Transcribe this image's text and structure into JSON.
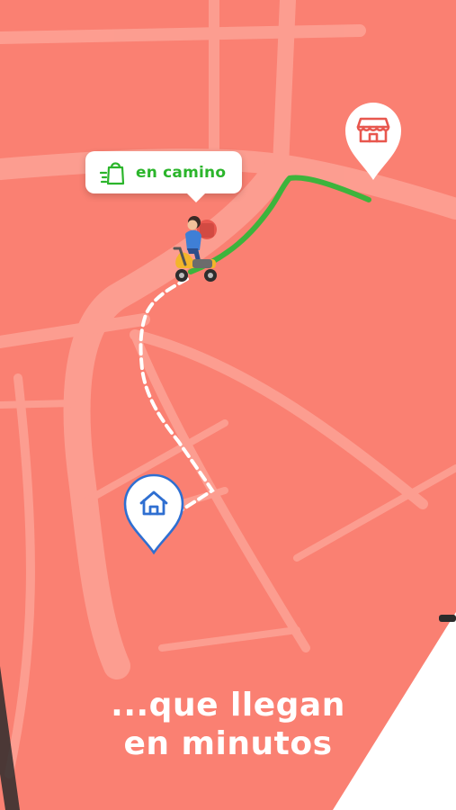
{
  "screen": {
    "background_color": "#FA8072",
    "road_color": "#FDA79B",
    "route_done_color": "#3DB43C",
    "route_pending_color": "#FFFFFF"
  },
  "status_bubble": {
    "label": "en camino",
    "icon": "shopping-bag-speed-icon",
    "text_color": "#2BB52B"
  },
  "markers": {
    "store": {
      "icon": "store-icon",
      "color": "#E8574E"
    },
    "home": {
      "icon": "home-icon",
      "color": "#2F6FD1"
    }
  },
  "courier": {
    "icon": "scooter-rider-icon"
  },
  "headline": {
    "line1": "...que llegan",
    "line2": "en minutos"
  }
}
